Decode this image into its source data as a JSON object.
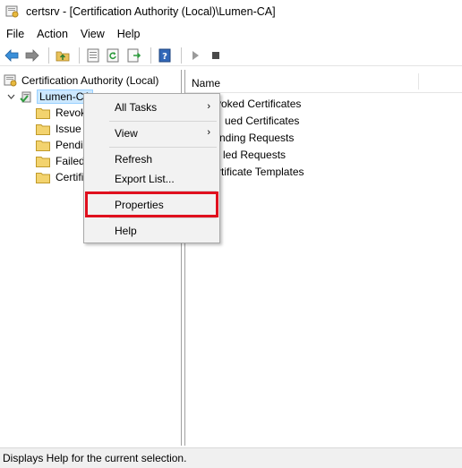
{
  "window": {
    "title": "certsrv - [Certification Authority (Local)\\Lumen-CA]",
    "app_icon": "certsrv-app-icon"
  },
  "menubar": {
    "items": [
      "File",
      "Action",
      "View",
      "Help"
    ]
  },
  "toolbar": {
    "buttons": [
      "back-arrow-icon",
      "forward-arrow-icon",
      "up-folder-icon",
      "show-hide-tree-icon",
      "refresh-icon",
      "export-list-icon",
      "help-icon",
      "start-service-icon",
      "stop-service-icon"
    ]
  },
  "tree": {
    "root": "Certification Authority (Local)",
    "ca_node": "Lumen-CA",
    "folders": [
      "Revoked Certificates",
      "Issued Certificates",
      "Pending Requests",
      "Failed Requests",
      "Certificate Templates"
    ],
    "folders_visible": [
      "Revok",
      "Issue",
      "Pendi",
      "Failed",
      "Certifi"
    ]
  },
  "list": {
    "column_header": "Name",
    "items": [
      "Revoked Certificates",
      "Issued Certificates",
      "Pending Requests",
      "Failed Requests",
      "Certificate Templates"
    ],
    "items_visible": [
      "voked Certificates",
      "ued Certificates",
      "nding Requests",
      "led Requests",
      "rtificate Templates"
    ]
  },
  "context_menu": {
    "items": [
      {
        "label": "All Tasks",
        "submenu": true
      },
      {
        "label": "View",
        "submenu": true
      },
      {
        "label": "Refresh",
        "submenu": false
      },
      {
        "label": "Export List...",
        "submenu": false
      },
      {
        "label": "Properties",
        "submenu": false,
        "highlighted": true
      },
      {
        "label": "Help",
        "submenu": false
      }
    ],
    "submenu_arrow": "›",
    "highlight_color": "#e0101e"
  },
  "statusbar": {
    "text": "Displays Help for the current selection."
  }
}
